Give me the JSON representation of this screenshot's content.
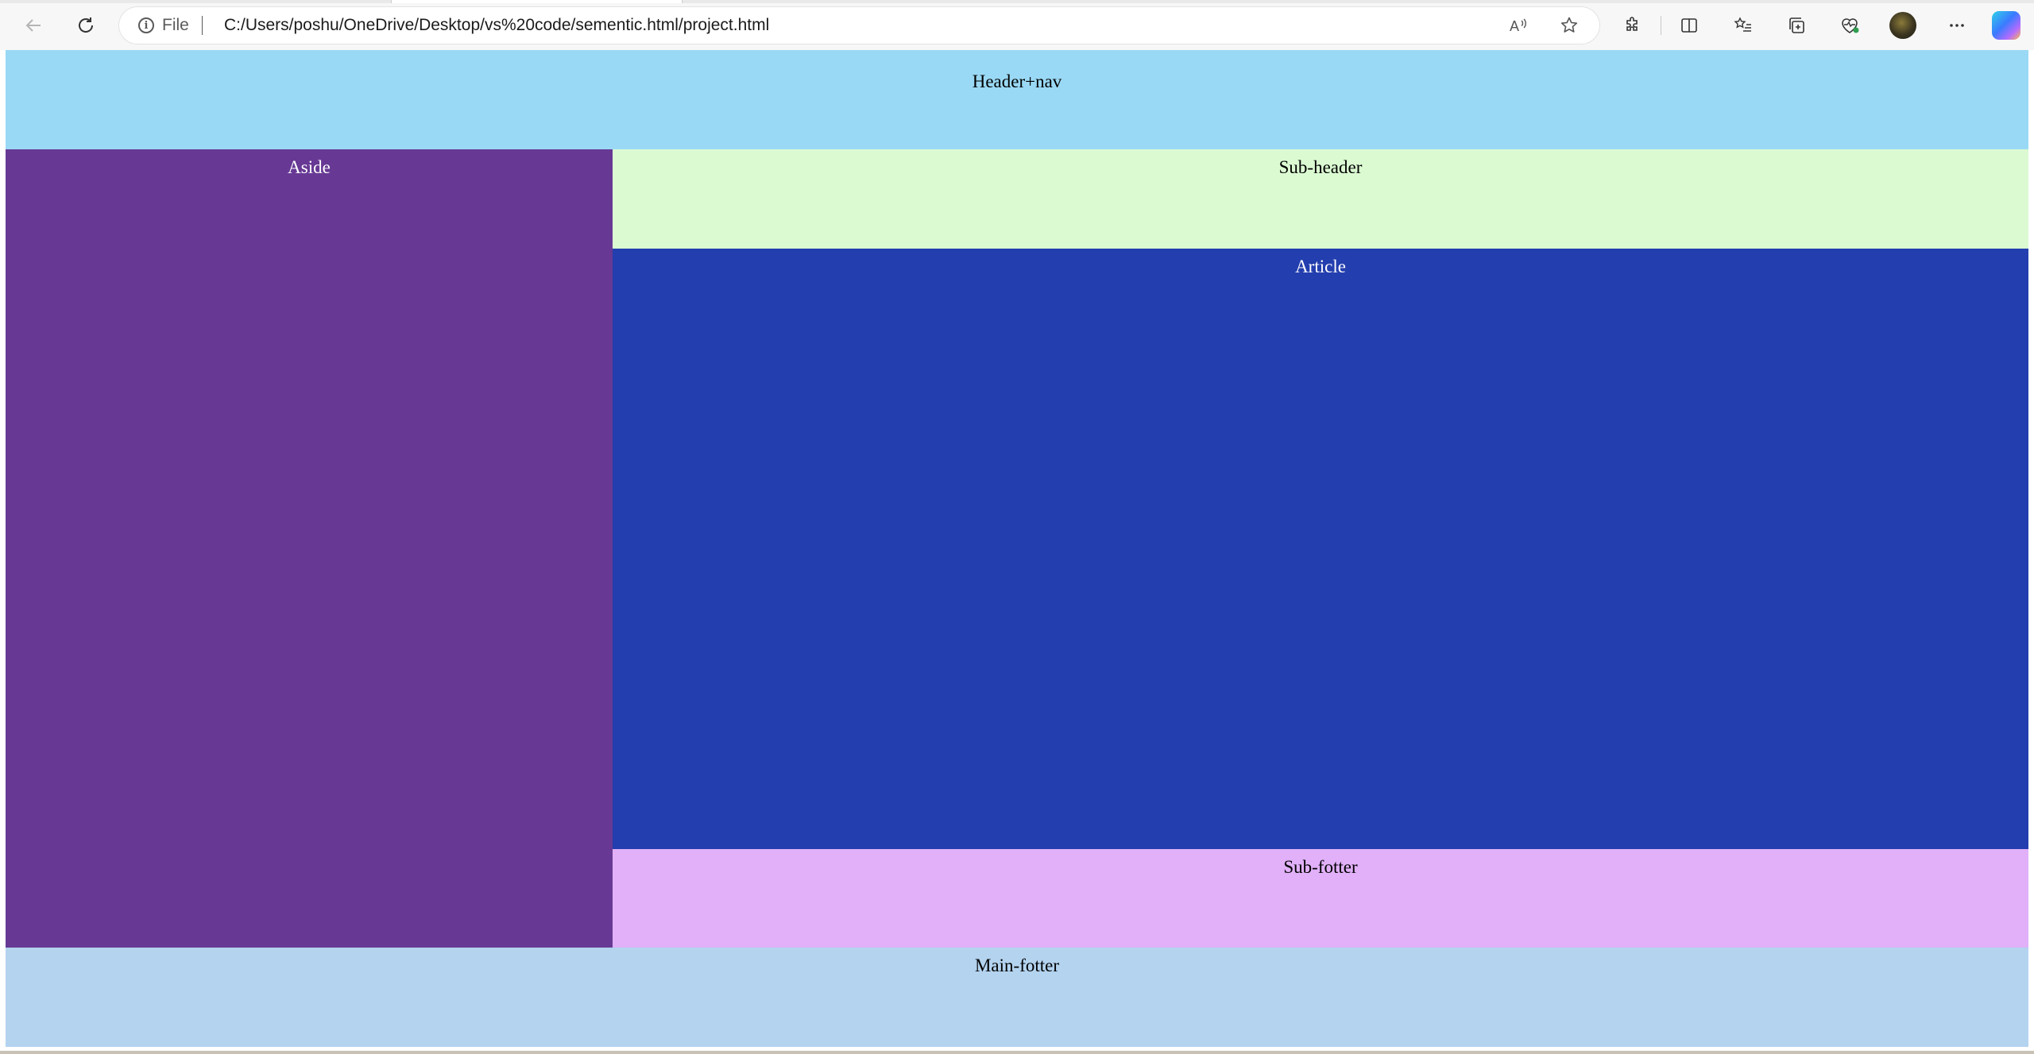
{
  "browser": {
    "address": {
      "scheme_label": "File",
      "url": "C:/Users/poshu/OneDrive/Desktop/vs%20code/sementic.html/project.html"
    },
    "icons": {
      "back": "back-arrow-icon",
      "refresh": "refresh-icon",
      "info": "info-icon",
      "read_aloud": "read-aloud-icon",
      "favorite": "star-icon",
      "extensions": "puzzle-icon",
      "split_screen": "split-screen-icon",
      "favorites": "favorites-list-icon",
      "collections": "collections-icon",
      "health": "browser-essentials-icon",
      "more": "more-icon",
      "copilot": "copilot-icon"
    }
  },
  "layout": {
    "header": {
      "label": "Header+nav",
      "bg": "#9ad9f5",
      "color": "#000000"
    },
    "aside": {
      "label": "Aside",
      "bg": "#673994",
      "color": "#ffffff"
    },
    "subheader": {
      "label": "Sub-header",
      "bg": "#dbfad2",
      "color": "#000000"
    },
    "article": {
      "label": "Article",
      "bg": "#233eae",
      "color": "#ffffff"
    },
    "subfooter": {
      "label": "Sub-fotter",
      "bg": "#e1b0f8",
      "color": "#000000"
    },
    "mainfooter": {
      "label": "Main-fotter",
      "bg": "#b3d3ef",
      "color": "#000000"
    }
  }
}
